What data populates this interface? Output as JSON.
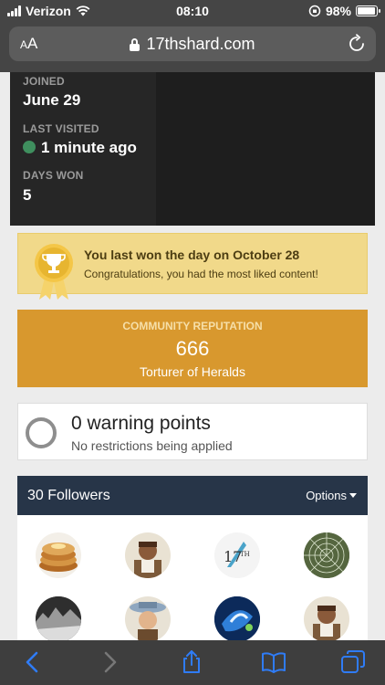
{
  "status_bar": {
    "carrier": "Verizon",
    "time": "08:10",
    "battery": "98%",
    "battery_level": 0.98
  },
  "browser": {
    "text_size_label": "AA",
    "url": "17thshard.com"
  },
  "profile": {
    "joined_label": "JOINED",
    "joined_value": "June 29",
    "last_visited_label": "LAST VISITED",
    "last_visited_value": "1 minute ago",
    "days_won_label": "DAYS WON",
    "days_won_value": "5"
  },
  "win_banner": {
    "title": "You last won the day on October 28",
    "subtitle": "Congratulations, you had the most liked content!"
  },
  "reputation": {
    "label": "COMMUNITY REPUTATION",
    "value": "666",
    "rank": "Torturer of Heralds"
  },
  "warnings": {
    "title": "0 warning points",
    "subtitle": "No restrictions being applied"
  },
  "followers": {
    "title": "30 Followers",
    "options_label": "Options"
  },
  "colors": {
    "online": "#3f8f5e",
    "reputation_bg": "#d8982e",
    "banner_bg": "#f1d98a",
    "followers_header": "#273548",
    "ios_blue": "#2f7cf6"
  },
  "icons": [
    "wifi-icon",
    "lock-icon",
    "reload-icon",
    "trophy-icon",
    "back-icon",
    "forward-icon",
    "share-icon",
    "bookmarks-icon",
    "tabs-icon",
    "caret-down-icon"
  ]
}
